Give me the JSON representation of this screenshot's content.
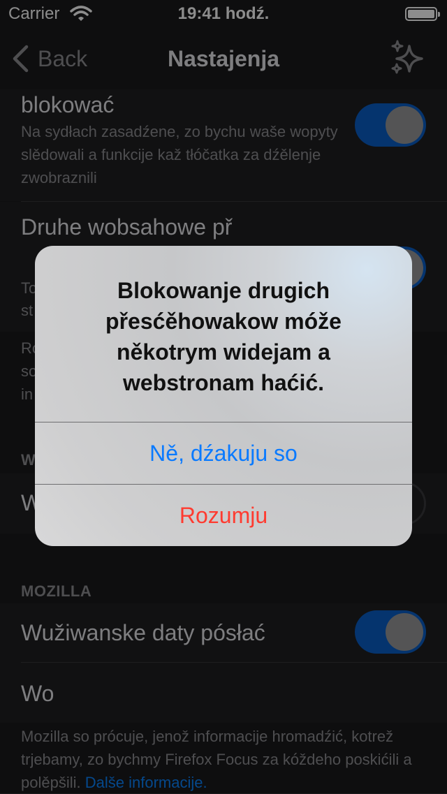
{
  "status_bar": {
    "carrier": "Carrier",
    "time": "19:41 hodź."
  },
  "nav": {
    "back_label": "Back",
    "title": "Nastajenja"
  },
  "cells": {
    "social": {
      "title": "blokować",
      "subtitle": "Na sydłach zasadźene, zo bychu waše wopyty slědowali a funkcije kaž tłóčatka za dźělenje zwobraznili",
      "toggle_on": true
    },
    "other": {
      "title": "Druhe wobsahowe př",
      "subtitle": "To st",
      "toggle_on": true
    },
    "other_footer": "Ro so in",
    "web_section": "W",
    "web_cell": {
      "title": "W",
      "toggle_on": false
    },
    "mozilla_section": "MOZILLA",
    "usage": {
      "title": "Wužiwanske daty pósłać",
      "toggle_on": true
    },
    "wo": {
      "title": "Wo"
    },
    "mozilla_footer": {
      "text": "Mozilla so prócuje, jenož informacije hromadźić, kotrež trjebamy, zo bychmy Firefox Focus za kóždeho poskićili a polěpšili.",
      "link": "Dalše informacije."
    }
  },
  "alert": {
    "message": "Blokowanje drugich přesćěhowakow móže někotrym widejam a webstronam haćić.",
    "cancel_label": "Ně, dźakuju so",
    "confirm_label": "Rozumju"
  },
  "colors": {
    "accent": "#0a84ff",
    "destructive": "#ff3b30",
    "toggle_on": "#0a60c8"
  },
  "icons": {
    "back": "chevron-left-icon",
    "whats_new": "sparkle-icon",
    "wifi": "wifi-icon",
    "battery": "battery-icon"
  }
}
